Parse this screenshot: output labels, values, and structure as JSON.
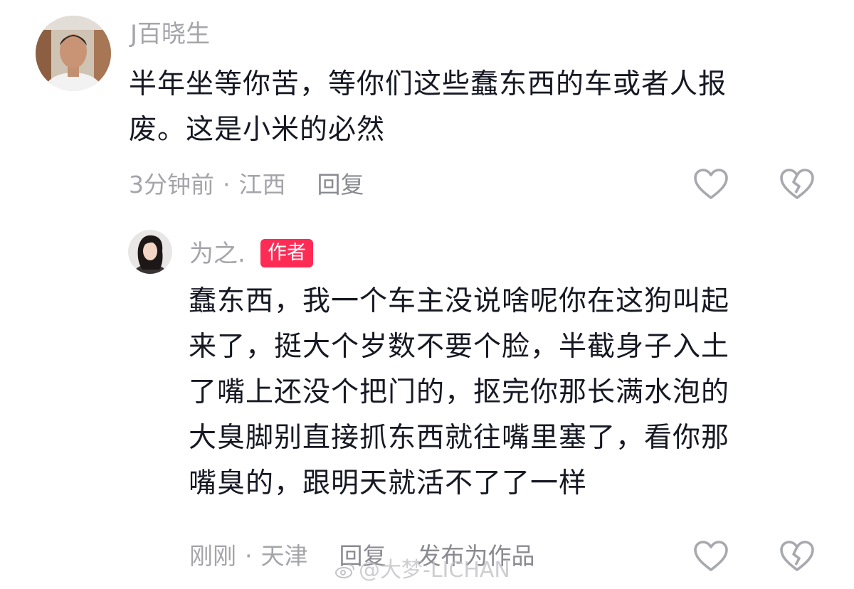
{
  "comment": {
    "username": "J百晓生",
    "lines": [
      "半年坐等你苦，等你们这些蠢东西的车或者人报",
      "废。这是小米的必然"
    ],
    "time": "3分钟前",
    "separator": "·",
    "location": "江西",
    "reply_label": "回复",
    "like_icon": "heart-outline-icon",
    "dislike_icon": "broken-heart-icon"
  },
  "reply": {
    "username": "为之.",
    "badge": "作者",
    "lines": [
      "蠢东西，我一个车主没说啥呢你在这狗叫起",
      "来了，挺大个岁数不要个脸，半截身子入土",
      "了嘴上还没个把门的，抠完你那长满水泡的",
      "大臭脚别直接抓东西就往嘴里塞了，看你那",
      "嘴臭的，跟明天就活不了了一样"
    ],
    "time": "刚刚",
    "separator": "·",
    "location": "天津",
    "reply_label": "回复",
    "publish_label": "发布为作品",
    "like_icon": "heart-outline-icon",
    "dislike_icon": "broken-heart-icon"
  },
  "watermark": {
    "text": "@大梦-LICHAN"
  },
  "colors": {
    "text": "#161823",
    "muted": "#a4a5aa",
    "badge": "#fe2c55"
  }
}
